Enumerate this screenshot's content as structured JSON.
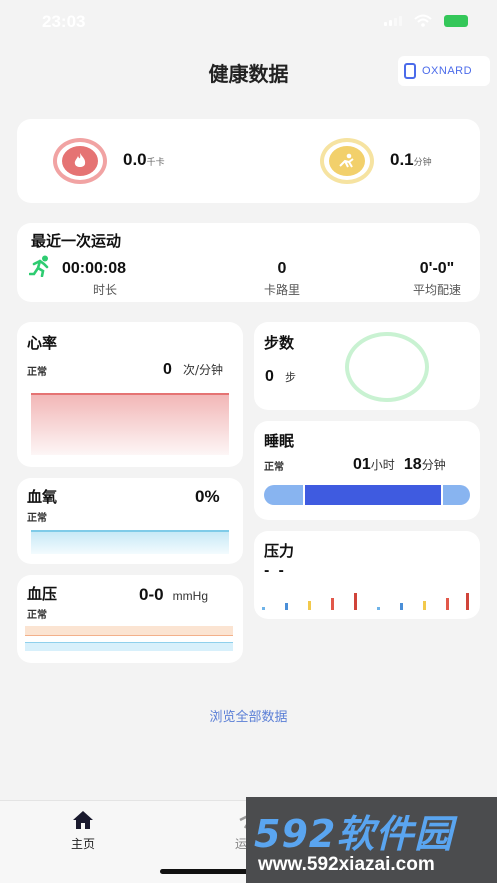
{
  "status_bar": {
    "time": "23:03"
  },
  "header": {
    "title": "健康数据",
    "device_label": "OXNARD"
  },
  "summary": {
    "calories": {
      "value": "0.0",
      "unit": "千卡",
      "icon": "flame-icon",
      "color": "#e57373"
    },
    "duration": {
      "value": "0.1",
      "unit": "分钟",
      "icon": "exercise-icon",
      "color": "#f2d06b"
    }
  },
  "last_exercise": {
    "title": "最近一次运动",
    "time": "00:00:08",
    "time_label": "时长",
    "calories": "0",
    "calories_label": "卡路里",
    "pace": "0'-0\"",
    "pace_label": "平均配速"
  },
  "heart_rate": {
    "title": "心率",
    "status": "正常",
    "value": "0",
    "unit": "次/分钟"
  },
  "blood_oxygen": {
    "title": "血氧",
    "status": "正常",
    "value": "0%"
  },
  "blood_pressure": {
    "title": "血压",
    "status": "正常",
    "value": "0-0",
    "unit": "mmHg"
  },
  "steps": {
    "title": "步数",
    "value": "0",
    "unit": "步"
  },
  "sleep": {
    "title": "睡眠",
    "status": "正常",
    "hours": "01",
    "hours_unit": "小时",
    "minutes": "18",
    "minutes_unit": "分钟"
  },
  "stress": {
    "title": "压力",
    "value": "-  -"
  },
  "browse_all": "浏览全部数据",
  "bottom_nav": {
    "home": "主页",
    "sport": "运动"
  },
  "watermark": {
    "brand": "592软件园",
    "url": "www.592xiazai.com"
  },
  "colors": {
    "accent": "#4b6bea",
    "link": "#5b7fd6"
  }
}
